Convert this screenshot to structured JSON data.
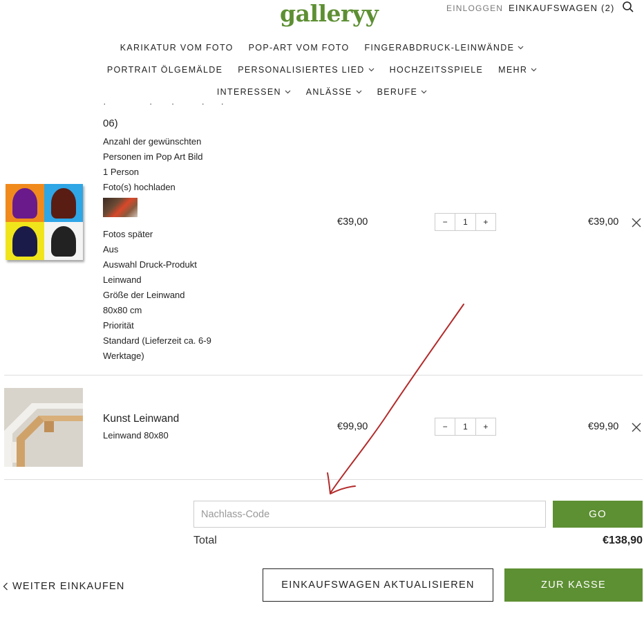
{
  "header": {
    "logo": "galleryy",
    "login": "EINLOGGEN",
    "cart": "EINKAUFSWAGEN (2)"
  },
  "nav": {
    "row1": [
      "KARIKATUR VOM FOTO",
      "POP-ART VOM FOTO",
      "FINGERABDRUCK-LEINWÄNDE"
    ],
    "row2": [
      "PORTRAIT ÖLGEMÄLDE",
      "PERSONALISIERTES LIED",
      "HOCHZEITSSPIELE",
      "MEHR"
    ],
    "row3": [
      "INTERESSEN",
      "ANLÄSSE",
      "BERUFE"
    ]
  },
  "cart": {
    "item1": {
      "option_lines": [
        "06)",
        "Anzahl der gewünschten",
        "Personen im Pop Art Bild",
        "1 Person",
        "Foto(s) hochladen",
        "Fotos später",
        "Aus",
        "Auswahl Druck-Produkt",
        "Leinwand",
        "Größe der Leinwand",
        "80x80 cm",
        "Priorität",
        "Standard (Lieferzeit ca. 6-9",
        "Werktage)"
      ],
      "price": "€39,00",
      "quantity": "1",
      "line_total": "€39,00"
    },
    "item2": {
      "title": "Kunst Leinwand",
      "variant": "Leinwand 80x80",
      "price": "€99,90",
      "quantity": "1",
      "line_total": "€99,90"
    },
    "qty_minus": "−",
    "qty_plus": "+",
    "discount_placeholder": "Nachlass-Code",
    "go_label": "GO",
    "total_label": "Total",
    "total_value": "€138,90",
    "continue_label": "WEITER EINKAUFEN",
    "update_label": "EINKAUFSWAGEN AKTUALISIEREN",
    "checkout_label": "ZUR KASSE"
  },
  "colors": {
    "brand_green": "#5d8f33",
    "annotation_arrow": "#b32a2a"
  }
}
